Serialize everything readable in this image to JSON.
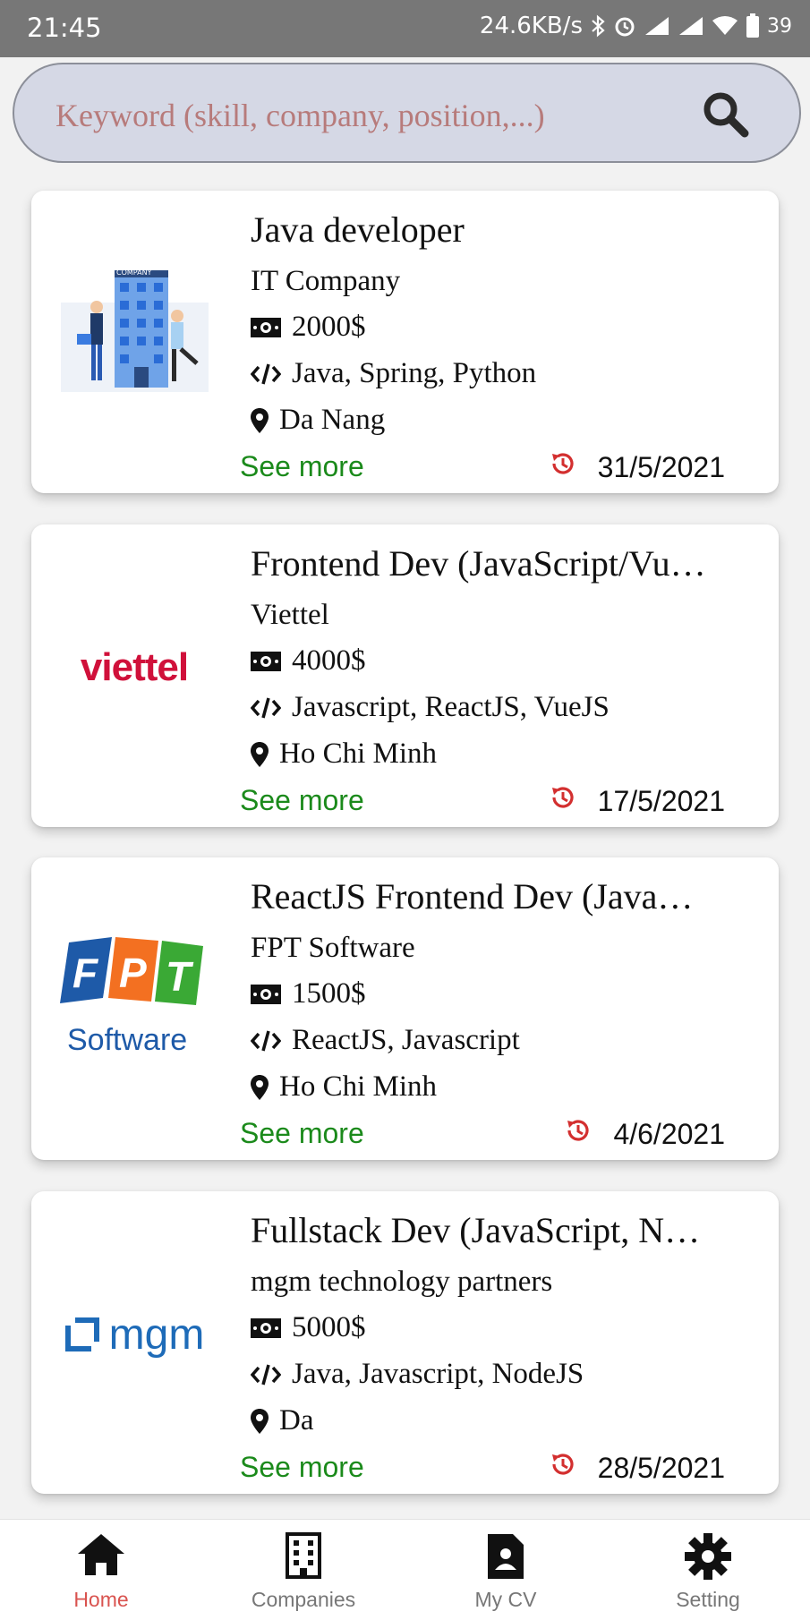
{
  "status_bar": {
    "time": "21:45",
    "speed": "24.6KB/s",
    "battery": "39",
    "icons": [
      "bluetooth-icon",
      "alarm-icon",
      "signal-icon",
      "signal-icon",
      "wifi-icon",
      "battery-icon"
    ]
  },
  "search": {
    "placeholder": "Keyword (skill, company, position,...)",
    "icon": "search-icon"
  },
  "jobs": [
    {
      "title": "Java developer",
      "company": "IT Company",
      "salary": "2000$",
      "skills": "Java, Spring, Python",
      "location": "Da Nang",
      "see_more": "See more",
      "date": "31/5/2021",
      "logo": "it-company-illustration"
    },
    {
      "title": "Frontend Dev (JavaScript/Vu…",
      "company": "Viettel",
      "salary": "4000$",
      "skills": "Javascript, ReactJS, VueJS",
      "location": "Ho Chi Minh",
      "see_more": "See more",
      "date": "17/5/2021",
      "logo": "viettel-logo",
      "logo_text": "viettel"
    },
    {
      "title": "ReactJS Frontend Dev (Java…",
      "company": "FPT Software",
      "salary": "1500$",
      "skills": "ReactJS, Javascript",
      "location": "Ho Chi Minh",
      "see_more": "See more",
      "date": "4/6/2021",
      "logo": "fpt-software-logo",
      "logo_text": "Software"
    },
    {
      "title": "Fullstack Dev (JavaScript, N…",
      "company": "mgm technology partners",
      "salary": "5000$",
      "skills": "Java, Javascript, NodeJS",
      "location": "Da",
      "see_more": "See more",
      "date": "28/5/2021",
      "logo": "mgm-logo",
      "logo_text": "mgm"
    }
  ],
  "nav": [
    {
      "label": "Home",
      "icon": "home-icon",
      "active": true
    },
    {
      "label": "Companies",
      "icon": "building-icon",
      "active": false
    },
    {
      "label": "My CV",
      "icon": "cv-file-icon",
      "active": false
    },
    {
      "label": "Setting",
      "icon": "gear-icon",
      "active": false
    }
  ],
  "colors": {
    "accent_active": "#d9534f",
    "see_more": "#1b8a1b",
    "date_icon": "#d32f2f",
    "status_bar": "#777777",
    "search_bg": "#d5d8e5"
  }
}
